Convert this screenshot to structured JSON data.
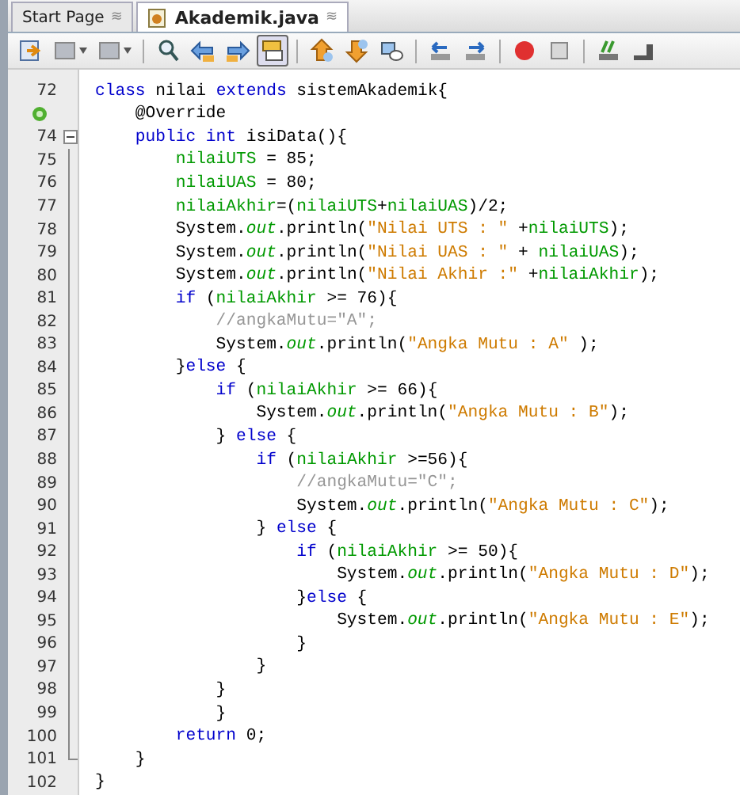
{
  "tabs": [
    {
      "label": "Start Page",
      "selected": false,
      "close": "≋"
    },
    {
      "label": "Akademik.java",
      "selected": true,
      "close": "≋"
    }
  ],
  "toolbar": [
    {
      "kind": "history",
      "selected": false
    },
    {
      "kind": "back",
      "selected": false
    },
    {
      "kind": "forward",
      "selected": false
    },
    {
      "kind": "sep"
    },
    {
      "kind": "find",
      "selected": false
    },
    {
      "kind": "find_prev",
      "selected": false
    },
    {
      "kind": "find_next",
      "selected": false
    },
    {
      "kind": "highlight",
      "selected": true
    },
    {
      "kind": "sep"
    },
    {
      "kind": "bookmark_prev",
      "selected": false
    },
    {
      "kind": "bookmark_next",
      "selected": false
    },
    {
      "kind": "bookmark",
      "selected": false
    },
    {
      "kind": "sep"
    },
    {
      "kind": "shift_left",
      "selected": false
    },
    {
      "kind": "shift_right",
      "selected": false
    },
    {
      "kind": "sep"
    },
    {
      "kind": "record",
      "selected": false
    },
    {
      "kind": "stop",
      "selected": false
    },
    {
      "kind": "sep"
    },
    {
      "kind": "comment",
      "selected": false
    },
    {
      "kind": "uncomment",
      "selected": false
    }
  ],
  "lines": [
    {
      "number": "72",
      "tokens": [
        {
          "kind": "keyword",
          "text": "class"
        },
        {
          "kind": "plain",
          "text": " nilai "
        },
        {
          "kind": "keyword",
          "text": "extends"
        },
        {
          "kind": "plain",
          "text": " sistemAkademik{"
        }
      ]
    },
    {
      "override": true,
      "tokens": [
        {
          "kind": "plain",
          "text": "    @Override"
        }
      ]
    },
    {
      "number": "74",
      "fold_start": true,
      "tokens": [
        {
          "kind": "keyword",
          "text": "    public int"
        },
        {
          "kind": "plain",
          "text": " isiData(){"
        }
      ]
    },
    {
      "number": "75",
      "tokens": [
        {
          "kind": "field",
          "text": "        nilaiUTS"
        },
        {
          "kind": "plain",
          "text": " = 85;"
        }
      ]
    },
    {
      "number": "76",
      "tokens": [
        {
          "kind": "field",
          "text": "        nilaiUAS"
        },
        {
          "kind": "plain",
          "text": " = 80;"
        }
      ]
    },
    {
      "number": "77",
      "tokens": [
        {
          "kind": "field",
          "text": "        nilaiAkhir"
        },
        {
          "kind": "plain",
          "text": "=("
        },
        {
          "kind": "field",
          "text": "nilaiUTS"
        },
        {
          "kind": "plain",
          "text": "+"
        },
        {
          "kind": "field",
          "text": "nilaiUAS"
        },
        {
          "kind": "plain",
          "text": ")/2;"
        }
      ]
    },
    {
      "number": "78",
      "tokens": [
        {
          "kind": "plain",
          "text": "        System."
        },
        {
          "kind": "static",
          "text": "out"
        },
        {
          "kind": "plain",
          "text": ".println("
        },
        {
          "kind": "string",
          "text": "\"Nilai UTS : \""
        },
        {
          "kind": "plain",
          "text": " +"
        },
        {
          "kind": "field",
          "text": "nilaiUTS"
        },
        {
          "kind": "plain",
          "text": ");"
        }
      ]
    },
    {
      "number": "79",
      "tokens": [
        {
          "kind": "plain",
          "text": "        System."
        },
        {
          "kind": "static",
          "text": "out"
        },
        {
          "kind": "plain",
          "text": ".println("
        },
        {
          "kind": "string",
          "text": "\"Nilai UAS : \""
        },
        {
          "kind": "plain",
          "text": " + "
        },
        {
          "kind": "field",
          "text": "nilaiUAS"
        },
        {
          "kind": "plain",
          "text": ");"
        }
      ]
    },
    {
      "number": "80",
      "tokens": [
        {
          "kind": "plain",
          "text": "        System."
        },
        {
          "kind": "static",
          "text": "out"
        },
        {
          "kind": "plain",
          "text": ".println("
        },
        {
          "kind": "string",
          "text": "\"Nilai Akhir :\""
        },
        {
          "kind": "plain",
          "text": " +"
        },
        {
          "kind": "field",
          "text": "nilaiAkhir"
        },
        {
          "kind": "plain",
          "text": ");"
        }
      ]
    },
    {
      "number": "81",
      "tokens": [
        {
          "kind": "keyword",
          "text": "        if"
        },
        {
          "kind": "plain",
          "text": " ("
        },
        {
          "kind": "field",
          "text": "nilaiAkhir"
        },
        {
          "kind": "plain",
          "text": " >= 76){"
        }
      ]
    },
    {
      "number": "82",
      "tokens": [
        {
          "kind": "comment",
          "text": "            //angkaMutu=\"A\";"
        }
      ]
    },
    {
      "number": "83",
      "tokens": [
        {
          "kind": "plain",
          "text": "            System."
        },
        {
          "kind": "static",
          "text": "out"
        },
        {
          "kind": "plain",
          "text": ".println("
        },
        {
          "kind": "string",
          "text": "\"Angka Mutu : A\""
        },
        {
          "kind": "plain",
          "text": " );"
        }
      ]
    },
    {
      "number": "84",
      "tokens": [
        {
          "kind": "plain",
          "text": "        }"
        },
        {
          "kind": "keyword",
          "text": "else"
        },
        {
          "kind": "plain",
          "text": " {"
        }
      ]
    },
    {
      "number": "85",
      "tokens": [
        {
          "kind": "keyword",
          "text": "            if"
        },
        {
          "kind": "plain",
          "text": " ("
        },
        {
          "kind": "field",
          "text": "nilaiAkhir"
        },
        {
          "kind": "plain",
          "text": " >= 66){"
        }
      ]
    },
    {
      "number": "86",
      "tokens": [
        {
          "kind": "plain",
          "text": "                System."
        },
        {
          "kind": "static",
          "text": "out"
        },
        {
          "kind": "plain",
          "text": ".println("
        },
        {
          "kind": "string",
          "text": "\"Angka Mutu : B\""
        },
        {
          "kind": "plain",
          "text": ");"
        }
      ]
    },
    {
      "number": "87",
      "tokens": [
        {
          "kind": "plain",
          "text": "            } "
        },
        {
          "kind": "keyword",
          "text": "else"
        },
        {
          "kind": "plain",
          "text": " {"
        }
      ]
    },
    {
      "number": "88",
      "tokens": [
        {
          "kind": "keyword",
          "text": "                if"
        },
        {
          "kind": "plain",
          "text": " ("
        },
        {
          "kind": "field",
          "text": "nilaiAkhir"
        },
        {
          "kind": "plain",
          "text": " >=56){"
        }
      ]
    },
    {
      "number": "89",
      "tokens": [
        {
          "kind": "comment",
          "text": "                    //angkaMutu=\"C\";"
        }
      ]
    },
    {
      "number": "90",
      "tokens": [
        {
          "kind": "plain",
          "text": "                    System."
        },
        {
          "kind": "static",
          "text": "out"
        },
        {
          "kind": "plain",
          "text": ".println("
        },
        {
          "kind": "string",
          "text": "\"Angka Mutu : C\""
        },
        {
          "kind": "plain",
          "text": ");"
        }
      ]
    },
    {
      "number": "91",
      "tokens": [
        {
          "kind": "plain",
          "text": "                } "
        },
        {
          "kind": "keyword",
          "text": "else"
        },
        {
          "kind": "plain",
          "text": " {"
        }
      ]
    },
    {
      "number": "92",
      "tokens": [
        {
          "kind": "keyword",
          "text": "                    if"
        },
        {
          "kind": "plain",
          "text": " ("
        },
        {
          "kind": "field",
          "text": "nilaiAkhir"
        },
        {
          "kind": "plain",
          "text": " >= 50){"
        }
      ]
    },
    {
      "number": "93",
      "tokens": [
        {
          "kind": "plain",
          "text": "                        System."
        },
        {
          "kind": "static",
          "text": "out"
        },
        {
          "kind": "plain",
          "text": ".println("
        },
        {
          "kind": "string",
          "text": "\"Angka Mutu : D\""
        },
        {
          "kind": "plain",
          "text": ");"
        }
      ]
    },
    {
      "number": "94",
      "tokens": [
        {
          "kind": "plain",
          "text": "                    }"
        },
        {
          "kind": "keyword",
          "text": "else"
        },
        {
          "kind": "plain",
          "text": " {"
        }
      ]
    },
    {
      "number": "95",
      "tokens": [
        {
          "kind": "plain",
          "text": "                        System."
        },
        {
          "kind": "static",
          "text": "out"
        },
        {
          "kind": "plain",
          "text": ".println("
        },
        {
          "kind": "string",
          "text": "\"Angka Mutu : E\""
        },
        {
          "kind": "plain",
          "text": ");"
        }
      ]
    },
    {
      "number": "96",
      "tokens": [
        {
          "kind": "plain",
          "text": "                    }"
        }
      ]
    },
    {
      "number": "97",
      "tokens": [
        {
          "kind": "plain",
          "text": "                }"
        }
      ]
    },
    {
      "number": "98",
      "tokens": [
        {
          "kind": "plain",
          "text": "            }"
        }
      ]
    },
    {
      "number": "99",
      "tokens": [
        {
          "kind": "plain",
          "text": "            }"
        }
      ]
    },
    {
      "number": "100",
      "tokens": [
        {
          "kind": "keyword",
          "text": "        return"
        },
        {
          "kind": "plain",
          "text": " 0;"
        }
      ]
    },
    {
      "number": "101",
      "fold_end": true,
      "tokens": [
        {
          "kind": "plain",
          "text": "    }"
        }
      ]
    },
    {
      "number": "102",
      "tokens": [
        {
          "kind": "plain",
          "text": "}"
        }
      ]
    }
  ]
}
